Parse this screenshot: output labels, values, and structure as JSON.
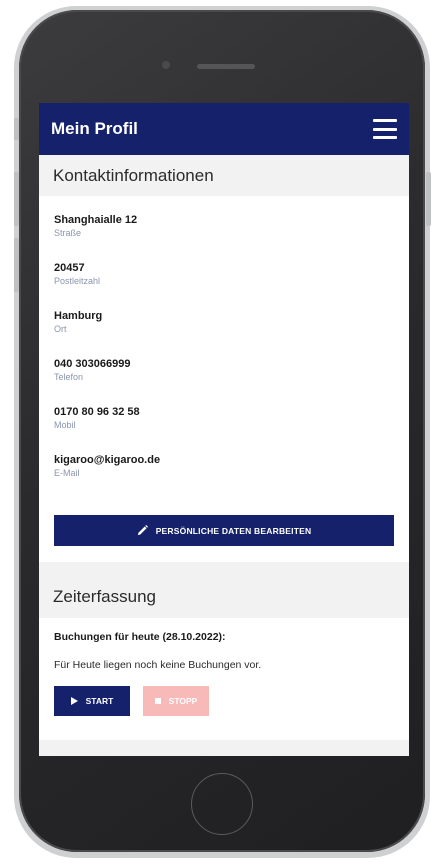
{
  "app": {
    "title": "Mein Profil"
  },
  "contact": {
    "section_title": "Kontaktinformationen",
    "items": [
      {
        "value": "Shanghaialle 12",
        "label": "Straße"
      },
      {
        "value": "20457",
        "label": "Postleitzahl"
      },
      {
        "value": "Hamburg",
        "label": "Ort"
      },
      {
        "value": "040 303066999",
        "label": "Telefon"
      },
      {
        "value": "0170 80 96 32 58",
        "label": "Mobil"
      },
      {
        "value": "kigaroo@kigaroo.de",
        "label": "E-Mail"
      }
    ],
    "edit_button_label": "PERSÖNLICHE DATEN BEARBEITEN"
  },
  "time_tracking": {
    "section_title": "Zeiterfassung",
    "bookings_heading": "Buchungen für heute (28.10.2022):",
    "bookings_empty": "Für Heute liegen noch keine Buchungen vor.",
    "start_label": "START",
    "stop_label": "STOPP"
  },
  "icons": {
    "menu": "hamburger-menu-icon",
    "edit": "pencil-icon",
    "start": "play-icon",
    "stop": "stop-square-icon"
  },
  "colors": {
    "primary": "#15216b",
    "stop_disabled": "#f8b9b9",
    "label_muted": "#8a96ad",
    "section_bg": "#f2f2f3"
  }
}
